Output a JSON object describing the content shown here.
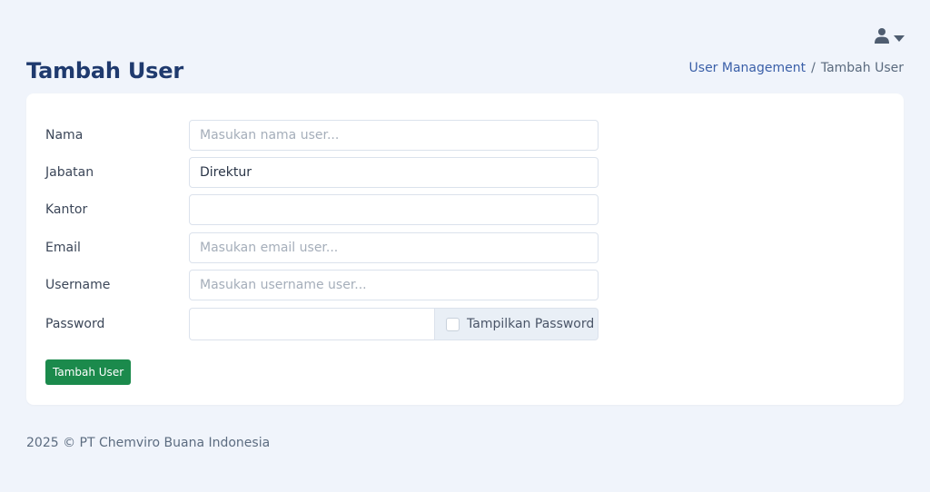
{
  "header": {
    "title": "Tambah User",
    "user_icon": "user-icon",
    "dropdown_icon": "caret-down-icon"
  },
  "breadcrumb": {
    "parent": "User Management",
    "separator": "/",
    "current": "Tambah User"
  },
  "form": {
    "nama": {
      "label": "Nama",
      "value": "",
      "placeholder": "Masukan nama user..."
    },
    "jabatan": {
      "label": "Jabatan",
      "value": "Direktur",
      "placeholder": ""
    },
    "kantor": {
      "label": "Kantor",
      "value": "",
      "placeholder": ""
    },
    "email": {
      "label": "Email",
      "value": "",
      "placeholder": "Masukan email user..."
    },
    "username": {
      "label": "Username",
      "value": "",
      "placeholder": "Masukan username user..."
    },
    "password": {
      "label": "Password",
      "value": "",
      "placeholder": "",
      "toggle_label": "Tampilkan Password"
    },
    "submit_label": "Tambah User"
  },
  "footer": {
    "text": "2025 © PT Chemviro Buana Indonesia"
  },
  "colors": {
    "background": "#f0f4fb",
    "title": "#1f3a6e",
    "link": "#3a5fa8",
    "submit": "#1b8a4c"
  }
}
